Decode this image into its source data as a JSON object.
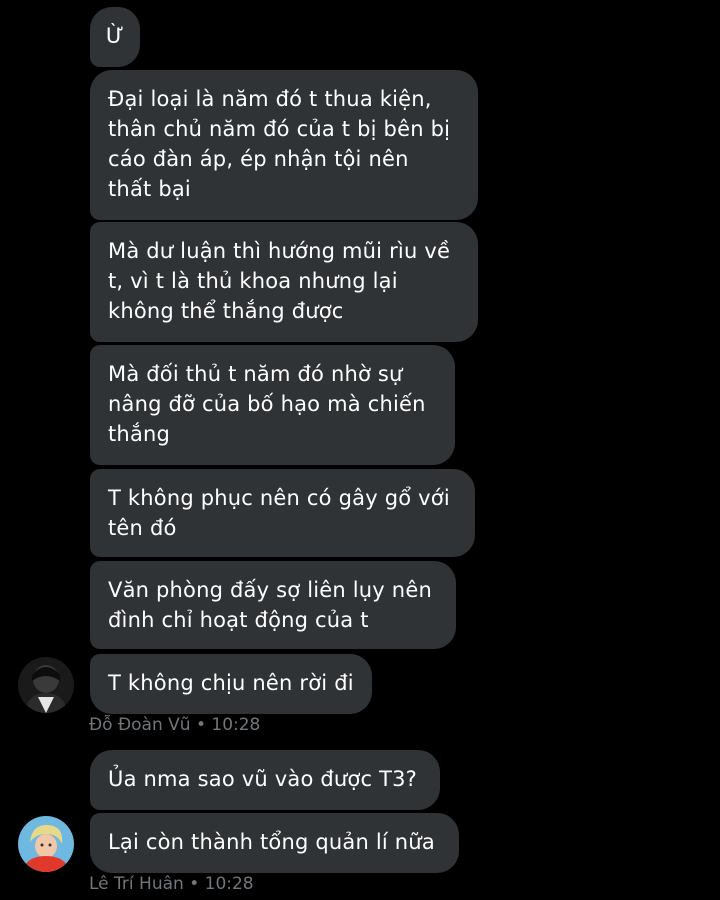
{
  "messages": [
    {
      "text": "Ừ"
    },
    {
      "text": "Đại loại là năm đó t thua kiện,\nthân chủ năm đó của t bị bên bị\ncáo đàn áp, ép nhận tội nên\nthất bại"
    },
    {
      "text": "Mà dư luận thì hướng mũi rìu về\nt, vì t là thủ khoa nhưng lại\nkhông thể thắng được"
    },
    {
      "text": "Mà đối thủ t năm đó nhờ sự\nnâng đỡ của bố hạo mà chiến\nthắng"
    },
    {
      "text": "T không phục nên có gây gổ với\ntên đó"
    },
    {
      "text": "Văn phòng đấy sợ liên lụy nên\nđình chỉ hoạt động của t"
    },
    {
      "text": "T không chịu nên rời đi"
    },
    {
      "text": "Ủa nma sao vũ vào được T3?"
    },
    {
      "text": "Lại còn thành tổng quản lí nữa"
    }
  ],
  "senders": [
    {
      "meta": "Đỗ Đoàn Vũ • 10:28",
      "avatar_icon": "user-avatar-dark"
    },
    {
      "meta": "Lê Trí Huân • 10:28",
      "avatar_icon": "user-avatar-colorful"
    }
  ],
  "colors": {
    "background": "#000000",
    "bubble": "#2f3336",
    "meta_text": "#71767b"
  }
}
